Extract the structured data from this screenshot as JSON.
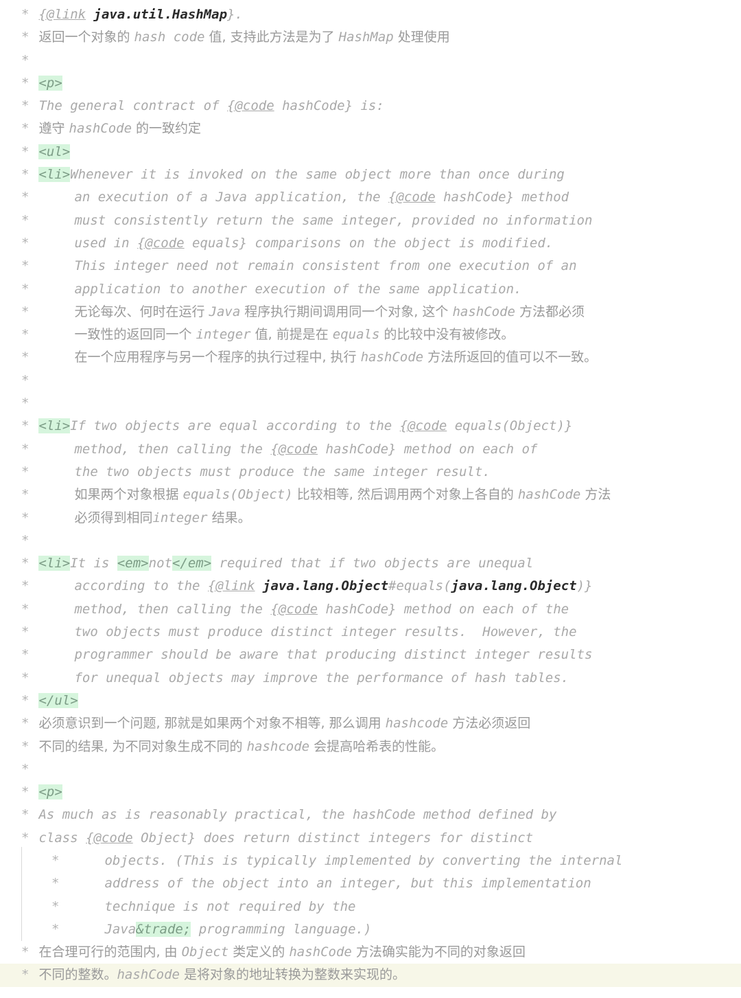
{
  "editor": {
    "kind": "code-editor",
    "language": "java",
    "content_type": "javadoc-comment",
    "colors": {
      "background": "#ffffff",
      "comment_text": "#a9a9a9",
      "cjk_text": "#9a9a9a",
      "tag_highlight_bg": "#d6f5dd",
      "tag_highlight_fg": "#7c9c86",
      "reference_bold": "#2b2b2b",
      "current_line_bg": "#f7f7e8",
      "indent_guide": "#d9d9d9"
    },
    "current_line_index": 42
  },
  "lines": [
    {
      "indent": 0,
      "star": "*",
      "segments": [
        {
          "type": "inlinetag",
          "text": "{@link"
        },
        {
          "type": "txt",
          "text": " "
        },
        {
          "type": "ref",
          "text": "java.util.HashMap"
        },
        {
          "type": "txt",
          "text": "}."
        }
      ]
    },
    {
      "indent": 0,
      "star": "*",
      "segments": [
        {
          "type": "cjk",
          "text": "返回一个对象的 "
        },
        {
          "type": "cjk-code",
          "text": "hash code"
        },
        {
          "type": "cjk",
          "text": " 值, 支持此方法是为了 "
        },
        {
          "type": "cjk-code",
          "text": "HashMap"
        },
        {
          "type": "cjk",
          "text": " 处理使用"
        }
      ]
    },
    {
      "indent": 0,
      "star": "*",
      "segments": []
    },
    {
      "indent": 0,
      "star": "*",
      "segments": [
        {
          "type": "tag",
          "text": "<p>"
        }
      ]
    },
    {
      "indent": 0,
      "star": "*",
      "segments": [
        {
          "type": "txt",
          "text": "The general contract of "
        },
        {
          "type": "inlinetag",
          "text": "{@code"
        },
        {
          "type": "txt",
          "text": " hashCode} is:"
        }
      ]
    },
    {
      "indent": 0,
      "star": "*",
      "segments": [
        {
          "type": "cjk",
          "text": "遵守 "
        },
        {
          "type": "cjk-code",
          "text": "hashCode"
        },
        {
          "type": "cjk",
          "text": " 的一致约定"
        }
      ]
    },
    {
      "indent": 0,
      "star": "*",
      "segments": [
        {
          "type": "tag",
          "text": "<ul>"
        }
      ]
    },
    {
      "indent": 0,
      "star": "*",
      "segments": [
        {
          "type": "tag",
          "text": "<li>"
        },
        {
          "type": "txt",
          "text": "Whenever it is invoked on the same object more than once during"
        }
      ]
    },
    {
      "indent": 1,
      "star": "*",
      "segments": [
        {
          "type": "txt",
          "text": "an execution of a Java application, the "
        },
        {
          "type": "inlinetag",
          "text": "{@code"
        },
        {
          "type": "txt",
          "text": " hashCode} method"
        }
      ]
    },
    {
      "indent": 1,
      "star": "*",
      "segments": [
        {
          "type": "txt",
          "text": "must consistently return the same integer, provided no information"
        }
      ]
    },
    {
      "indent": 1,
      "star": "*",
      "segments": [
        {
          "type": "txt",
          "text": "used in "
        },
        {
          "type": "inlinetag",
          "text": "{@code"
        },
        {
          "type": "txt",
          "text": " equals} comparisons on the object is modified."
        }
      ]
    },
    {
      "indent": 1,
      "star": "*",
      "segments": [
        {
          "type": "txt",
          "text": "This integer need not remain consistent from one execution of an"
        }
      ]
    },
    {
      "indent": 1,
      "star": "*",
      "segments": [
        {
          "type": "txt",
          "text": "application to another execution of the same application."
        }
      ]
    },
    {
      "indent": 1,
      "star": "*",
      "segments": [
        {
          "type": "cjk",
          "text": "无论每次、何时在运行 "
        },
        {
          "type": "cjk-code",
          "text": "Java"
        },
        {
          "type": "cjk",
          "text": " 程序执行期间调用同一个对象, 这个 "
        },
        {
          "type": "cjk-code",
          "text": "hashCode"
        },
        {
          "type": "cjk",
          "text": " 方法都必须"
        }
      ]
    },
    {
      "indent": 1,
      "star": "*",
      "segments": [
        {
          "type": "cjk",
          "text": "一致性的返回同一个 "
        },
        {
          "type": "cjk-code",
          "text": "integer"
        },
        {
          "type": "cjk",
          "text": " 值, 前提是在 "
        },
        {
          "type": "cjk-code",
          "text": "equals"
        },
        {
          "type": "cjk",
          "text": " 的比较中没有被修改。"
        }
      ]
    },
    {
      "indent": 1,
      "star": "*",
      "segments": [
        {
          "type": "cjk",
          "text": "在一个应用程序与另一个程序的执行过程中, 执行 "
        },
        {
          "type": "cjk-code",
          "text": "hashCode"
        },
        {
          "type": "cjk",
          "text": " 方法所返回的值可以不一致。"
        }
      ]
    },
    {
      "indent": 0,
      "star": "*",
      "segments": []
    },
    {
      "indent": 0,
      "star": "*",
      "segments": []
    },
    {
      "indent": 0,
      "star": "*",
      "segments": [
        {
          "type": "tag",
          "text": "<li>"
        },
        {
          "type": "txt",
          "text": "If two objects are equal according to the "
        },
        {
          "type": "inlinetag",
          "text": "{@code"
        },
        {
          "type": "txt",
          "text": " equals(Object)}"
        }
      ]
    },
    {
      "indent": 1,
      "star": "*",
      "segments": [
        {
          "type": "txt",
          "text": "method, then calling the "
        },
        {
          "type": "inlinetag",
          "text": "{@code"
        },
        {
          "type": "txt",
          "text": " hashCode} method on each of"
        }
      ]
    },
    {
      "indent": 1,
      "star": "*",
      "segments": [
        {
          "type": "txt",
          "text": "the two objects must produce the same integer result."
        }
      ]
    },
    {
      "indent": 1,
      "star": "*",
      "segments": [
        {
          "type": "cjk",
          "text": "如果两个对象根据 "
        },
        {
          "type": "cjk-code",
          "text": "equals(Object)"
        },
        {
          "type": "cjk",
          "text": " 比较相等, 然后调用两个对象上各自的 "
        },
        {
          "type": "cjk-code",
          "text": "hashCode"
        },
        {
          "type": "cjk",
          "text": " 方法"
        }
      ]
    },
    {
      "indent": 1,
      "star": "*",
      "segments": [
        {
          "type": "cjk",
          "text": "必须得到相同"
        },
        {
          "type": "cjk-code",
          "text": "integer"
        },
        {
          "type": "cjk",
          "text": " 结果。"
        }
      ]
    },
    {
      "indent": 0,
      "star": "*",
      "segments": []
    },
    {
      "indent": 0,
      "star": "*",
      "segments": [
        {
          "type": "tag",
          "text": "<li>"
        },
        {
          "type": "txt",
          "text": "It is "
        },
        {
          "type": "tag",
          "text": "<em>"
        },
        {
          "type": "txt",
          "text": "not"
        },
        {
          "type": "tag",
          "text": "</em>"
        },
        {
          "type": "txt",
          "text": " required that if two objects are unequal"
        }
      ]
    },
    {
      "indent": 1,
      "star": "*",
      "segments": [
        {
          "type": "txt",
          "text": "according to the "
        },
        {
          "type": "inlinetag",
          "text": "{@link"
        },
        {
          "type": "txt",
          "text": " "
        },
        {
          "type": "ref",
          "text": "java.lang.Object"
        },
        {
          "type": "txt",
          "text": "#equals("
        },
        {
          "type": "ref",
          "text": "java.lang.Object"
        },
        {
          "type": "txt",
          "text": ")}"
        }
      ]
    },
    {
      "indent": 1,
      "star": "*",
      "segments": [
        {
          "type": "txt",
          "text": "method, then calling the "
        },
        {
          "type": "inlinetag",
          "text": "{@code"
        },
        {
          "type": "txt",
          "text": " hashCode} method on each of the"
        }
      ]
    },
    {
      "indent": 1,
      "star": "*",
      "segments": [
        {
          "type": "txt",
          "text": "two objects must produce distinct integer results.  However, the"
        }
      ]
    },
    {
      "indent": 1,
      "star": "*",
      "segments": [
        {
          "type": "txt",
          "text": "programmer should be aware that producing distinct integer results"
        }
      ]
    },
    {
      "indent": 1,
      "star": "*",
      "segments": [
        {
          "type": "txt",
          "text": "for unequal objects may improve the performance of hash tables."
        }
      ]
    },
    {
      "indent": 0,
      "star": "*",
      "segments": [
        {
          "type": "tag",
          "text": "</ul>"
        }
      ]
    },
    {
      "indent": 0,
      "star": "*",
      "segments": [
        {
          "type": "cjk",
          "text": "必须意识到一个问题, 那就是如果两个对象不相等, 那么调用 "
        },
        {
          "type": "cjk-code",
          "text": "hashcode"
        },
        {
          "type": "cjk",
          "text": " 方法必须返回"
        }
      ]
    },
    {
      "indent": 0,
      "star": "*",
      "segments": [
        {
          "type": "cjk",
          "text": "不同的结果, 为不同对象生成不同的 "
        },
        {
          "type": "cjk-code",
          "text": "hashcode"
        },
        {
          "type": "cjk",
          "text": " 会提高哈希表的性能。"
        }
      ]
    },
    {
      "indent": 0,
      "star": "*",
      "segments": []
    },
    {
      "indent": 0,
      "star": "*",
      "segments": [
        {
          "type": "tag",
          "text": "<p>"
        }
      ]
    },
    {
      "indent": 0,
      "star": "*",
      "segments": [
        {
          "type": "txt",
          "text": "As much as is reasonably practical, the hashCode method defined by"
        }
      ]
    },
    {
      "indent": 0,
      "star": "*",
      "segments": [
        {
          "type": "txt",
          "text": "class "
        },
        {
          "type": "inlinetag",
          "text": "{@code"
        },
        {
          "type": "txt",
          "text": " Object} does return distinct integers for distinct"
        }
      ]
    },
    {
      "indent": 2,
      "star": "*",
      "segments": [
        {
          "type": "txt",
          "text": "objects. (This is typically implemented by converting the internal"
        }
      ]
    },
    {
      "indent": 2,
      "star": "*",
      "segments": [
        {
          "type": "txt",
          "text": "address of the object into an integer, but this implementation"
        }
      ]
    },
    {
      "indent": 2,
      "star": "*",
      "segments": [
        {
          "type": "txt",
          "text": "technique is not required by the"
        }
      ]
    },
    {
      "indent": 2,
      "star": "*",
      "segments": [
        {
          "type": "txt",
          "text": "Java"
        },
        {
          "type": "entity",
          "text": "&trade;"
        },
        {
          "type": "txt",
          "text": " programming language.)"
        }
      ]
    },
    {
      "indent": 0,
      "star": "*",
      "segments": [
        {
          "type": "cjk",
          "text": "在合理可行的范围内, 由 "
        },
        {
          "type": "cjk-code",
          "text": "Object"
        },
        {
          "type": "cjk",
          "text": " 类定义的 "
        },
        {
          "type": "cjk-code",
          "text": "hashCode"
        },
        {
          "type": "cjk",
          "text": " 方法确实能为不同的对象返回"
        }
      ]
    },
    {
      "indent": 0,
      "star": "*",
      "segments": [
        {
          "type": "cjk",
          "text": "不同的整数。"
        },
        {
          "type": "cjk-code",
          "text": "hashCode"
        },
        {
          "type": "cjk",
          "text": " 是将对象的地址转换为整数来实现的。"
        }
      ]
    }
  ]
}
